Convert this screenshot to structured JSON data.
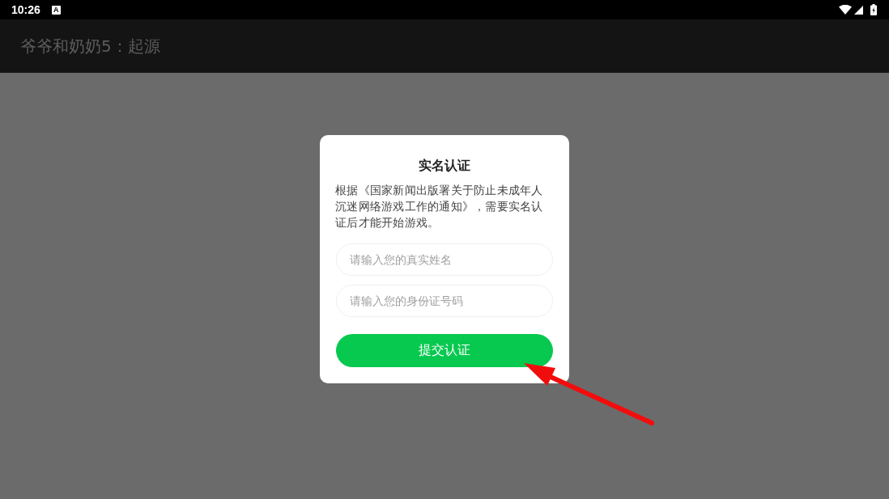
{
  "status_bar": {
    "time": "10:26",
    "notification_badge": "A"
  },
  "app_bar": {
    "title": "爷爷和奶奶5：起源"
  },
  "dialog": {
    "title": "实名认证",
    "message": "根据《国家新闻出版署关于防止未成年人沉迷网络游戏工作的通知》，需要实名认证后才能开始游戏。",
    "fields": [
      {
        "placeholder": "请输入您的真实姓名"
      },
      {
        "placeholder": "请输入您的身份证号码"
      }
    ],
    "submit_button": "提交认证"
  }
}
